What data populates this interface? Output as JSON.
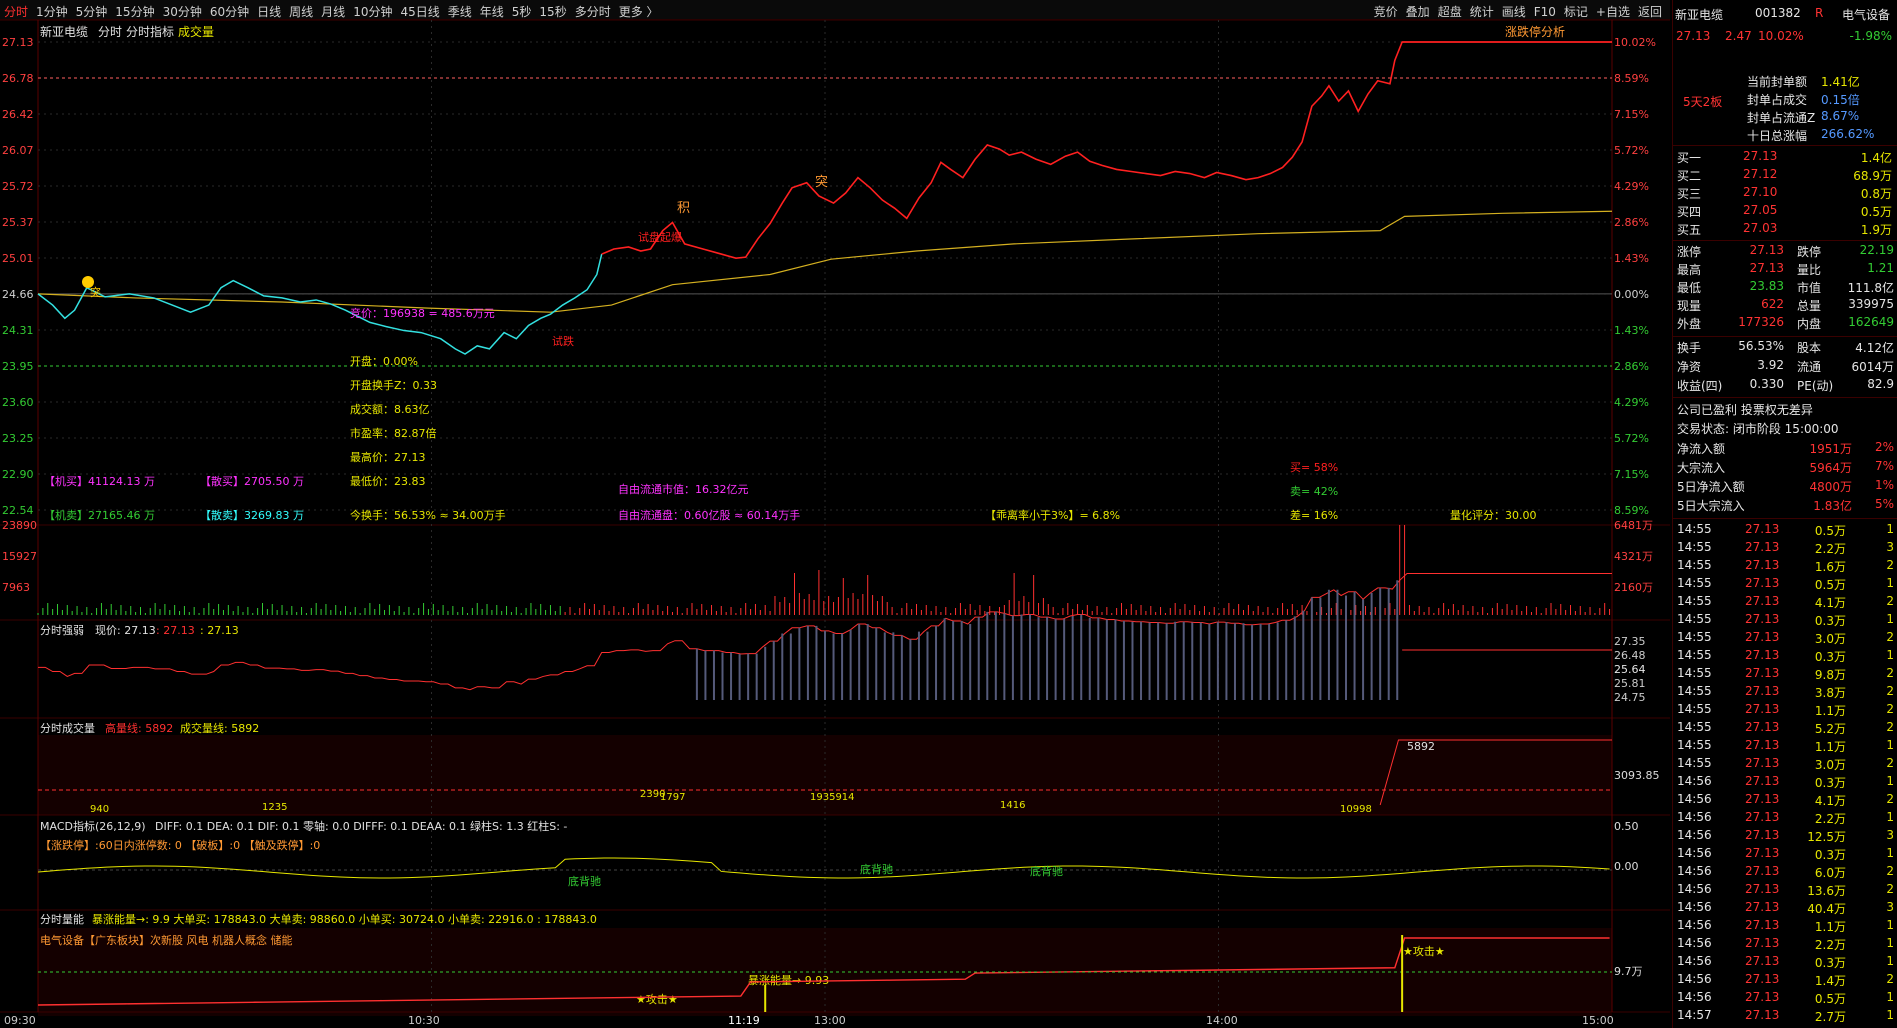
{
  "toolbar": {
    "left": [
      "分时",
      "1分钟",
      "5分钟",
      "15分钟",
      "30分钟",
      "60分钟",
      "日线",
      "周线",
      "月线",
      "10分钟",
      "45日线",
      "季线",
      "年线",
      "5秒",
      "15秒",
      "多分时",
      "更多 〉"
    ],
    "right": [
      "竞价",
      "叠加",
      "超盘",
      "统计",
      "画线",
      "F10",
      "标记",
      "+自选",
      "返回"
    ]
  },
  "header": {
    "stock_name": "新亚电缆",
    "tabs": [
      "分时",
      "分时指标",
      "成交量"
    ],
    "right_link": "涨跌停分析"
  },
  "price_axis": {
    "left": [
      "27.13",
      "26.78",
      "26.42",
      "26.07",
      "25.72",
      "25.37",
      "25.01",
      "24.66",
      "24.31",
      "23.95",
      "23.60",
      "23.25",
      "22.90",
      "22.54"
    ],
    "right": [
      "10.02%",
      "8.59%",
      "7.15%",
      "5.72%",
      "4.29%",
      "2.86%",
      "1.43%",
      "0.00%",
      "1.43%",
      "2.86%",
      "4.29%",
      "5.72%",
      "7.15%",
      "8.59%"
    ]
  },
  "main_annotations": {
    "auction": "竞价：196938 = 485.6万元",
    "stats": [
      "开盘：0.00%",
      "开盘换手Z：0.33",
      "成交额：8.63亿",
      "市盈率：82.87倍",
      "最高价：27.13",
      "最低价：23.83"
    ],
    "markers": [
      "突",
      "积",
      "突",
      "试盘起爆",
      "试跌",
      "买"
    ],
    "jimai": "【机买】41124.13 万",
    "sanmai": "【散买】2705.50 万",
    "jimai2": "【机卖】27165.46 万",
    "sanmai2": "【散卖】3269.83 万",
    "turnover": "今换手：56.53% ≈ 34.00万手",
    "float_value": "自由流通市值：16.32亿元",
    "float_shares": "自由流通盘：0.60亿股 ≈ 60.14万手",
    "deviation": "【乖离率小于3%】= 6.8%",
    "buy_ratio": "买= 58%",
    "sell_ratio": "卖= 42%",
    "diff_ratio": "差= 16%",
    "quant_score": "量化评分：30.00"
  },
  "volume_axis": {
    "left": [
      "23890",
      "15927",
      "7963"
    ],
    "right": [
      "6481万",
      "4321万",
      "2160万"
    ]
  },
  "panel_strength": {
    "title": "分时强弱",
    "now_label": "现价: 27.13",
    "v1": ": 27.13",
    "v2": ": 27.13",
    "axis": [
      "27.35",
      "26.48",
      "25.64",
      "25.81",
      "24.75"
    ]
  },
  "panel_volume": {
    "title": "分时成交量",
    "high_label": "高量线: 5892",
    "line_label": "成交量线: 5892",
    "axis": "3093.85",
    "peak": "5892",
    "labels": [
      "940",
      "1235",
      "1797",
      "2390",
      "1935914",
      "1416",
      "10998"
    ]
  },
  "panel_macd": {
    "title": "MACD指标(26,12,9)",
    "values": "DIFF: 0.1  DEA: 0.1  DIF: 0.1  零轴: 0.0  DIFFF: 0.1  DEAA: 0.1  绿柱S: 1.3  红柱S: -",
    "line2": "【涨跌停】:60日内涨停数: 0  【破板】:0  【触及跌停】:0",
    "axis": [
      "0.50",
      "0.00"
    ],
    "markers": [
      "底背驰",
      "底背驰",
      "底背驰"
    ]
  },
  "panel_energy": {
    "title": "分时量能",
    "values": "暴涨能量→: 9.9  大单买: 178843.0  大单卖: 98860.0  小单买: 30724.0  小单卖: 22916.0 : 178843.0",
    "sector": "电气设备【广东板块】次新股 风电 机器人概念 储能",
    "attack": "★攻击★",
    "energy_label": "暴涨能量→ 9.93",
    "axis": "9.7万"
  },
  "time_axis": [
    "09:30",
    "10:30",
    "11:19",
    "13:00",
    "14:00",
    "15:00"
  ],
  "quote": {
    "name": "新亚电缆",
    "code": "001382",
    "tag": "R",
    "sector": "电气设备",
    "sector_change": "-1.98%",
    "price": "27.13",
    "change": "2.47",
    "pct": "10.02%",
    "board_tag": "5天2板",
    "seal": [
      [
        "当前封单额",
        "1.41亿"
      ],
      [
        "封单占成交",
        "0.15倍"
      ],
      [
        "封单占流通Z",
        "8.67%"
      ],
      [
        "十日总涨幅",
        "266.62%"
      ]
    ],
    "bids": [
      [
        "买一",
        "27.13",
        "1.4亿"
      ],
      [
        "买二",
        "27.12",
        "68.9万"
      ],
      [
        "买三",
        "27.10",
        "0.8万"
      ],
      [
        "买四",
        "27.05",
        "0.5万"
      ],
      [
        "买五",
        "27.03",
        "1.9万"
      ]
    ],
    "stats": [
      [
        "涨停",
        "27.13",
        "跌停",
        "22.19"
      ],
      [
        "最高",
        "27.13",
        "量比",
        "1.21"
      ],
      [
        "最低",
        "23.83",
        "市值",
        "111.8亿"
      ],
      [
        "现量",
        "622",
        "总量",
        "339975"
      ],
      [
        "外盘",
        "177326",
        "内盘",
        "162649"
      ]
    ],
    "stats2": [
      [
        "换手",
        "56.53%",
        "股本",
        "4.12亿"
      ],
      [
        "净资",
        "3.92",
        "流通",
        "6014万"
      ],
      [
        "收益(四)",
        "0.330",
        "PE(动)",
        "82.9"
      ]
    ],
    "notice": "公司已盈利 投票权无差异",
    "status": "交易状态: 闭市阶段 15:00:00",
    "flows": [
      [
        "净流入额",
        "1951万",
        "2%"
      ],
      [
        "大宗流入",
        "5964万",
        "7%"
      ],
      [
        "5日净流入额",
        "4800万",
        "1%"
      ],
      [
        "5日大宗流入",
        "1.83亿",
        "5%"
      ]
    ],
    "ticks": [
      [
        "14:55",
        "27.13",
        "0.5万",
        "1"
      ],
      [
        "14:55",
        "27.13",
        "2.2万",
        "3"
      ],
      [
        "14:55",
        "27.13",
        "1.6万",
        "2"
      ],
      [
        "14:55",
        "27.13",
        "0.5万",
        "1"
      ],
      [
        "14:55",
        "27.13",
        "4.1万",
        "2"
      ],
      [
        "14:55",
        "27.13",
        "0.3万",
        "1"
      ],
      [
        "14:55",
        "27.13",
        "3.0万",
        "2"
      ],
      [
        "14:55",
        "27.13",
        "0.3万",
        "1"
      ],
      [
        "14:55",
        "27.13",
        "9.8万",
        "2"
      ],
      [
        "14:55",
        "27.13",
        "3.8万",
        "2"
      ],
      [
        "14:55",
        "27.13",
        "1.1万",
        "2"
      ],
      [
        "14:55",
        "27.13",
        "5.2万",
        "2"
      ],
      [
        "14:55",
        "27.13",
        "1.1万",
        "1"
      ],
      [
        "14:55",
        "27.13",
        "3.0万",
        "2"
      ],
      [
        "14:56",
        "27.13",
        "0.3万",
        "1"
      ],
      [
        "14:56",
        "27.13",
        "4.1万",
        "2"
      ],
      [
        "14:56",
        "27.13",
        "2.2万",
        "1"
      ],
      [
        "14:56",
        "27.13",
        "12.5万",
        "3"
      ],
      [
        "14:56",
        "27.13",
        "0.3万",
        "1"
      ],
      [
        "14:56",
        "27.13",
        "6.0万",
        "2"
      ],
      [
        "14:56",
        "27.13",
        "13.6万",
        "2"
      ],
      [
        "14:56",
        "27.13",
        "40.4万",
        "3"
      ],
      [
        "14:56",
        "27.13",
        "1.1万",
        "1"
      ],
      [
        "14:56",
        "27.13",
        "2.2万",
        "1"
      ],
      [
        "14:56",
        "27.13",
        "0.3万",
        "1"
      ],
      [
        "14:56",
        "27.13",
        "1.4万",
        "2"
      ],
      [
        "14:56",
        "27.13",
        "0.5万",
        "1"
      ],
      [
        "14:57",
        "27.13",
        "2.7万",
        "1"
      ]
    ]
  },
  "chart_data": {
    "type": "line",
    "title": "新亚电缆 分时",
    "prev_close": 24.66,
    "ylim": [
      22.54,
      27.13
    ],
    "price_series": [
      [
        0,
        24.66
      ],
      [
        12,
        24.55
      ],
      [
        22,
        24.42
      ],
      [
        30,
        24.5
      ],
      [
        40,
        24.72
      ],
      [
        55,
        24.63
      ],
      [
        75,
        24.66
      ],
      [
        95,
        24.62
      ],
      [
        110,
        24.55
      ],
      [
        125,
        24.48
      ],
      [
        140,
        24.55
      ],
      [
        150,
        24.72
      ],
      [
        160,
        24.79
      ],
      [
        172,
        24.72
      ],
      [
        185,
        24.64
      ],
      [
        200,
        24.62
      ],
      [
        215,
        24.58
      ],
      [
        228,
        24.6
      ],
      [
        240,
        24.56
      ],
      [
        252,
        24.5
      ],
      [
        262,
        24.44
      ],
      [
        272,
        24.38
      ],
      [
        285,
        24.34
      ],
      [
        300,
        24.3
      ],
      [
        314,
        24.28
      ],
      [
        330,
        24.22
      ],
      [
        342,
        24.12
      ],
      [
        350,
        24.07
      ],
      [
        360,
        24.15
      ],
      [
        370,
        24.12
      ],
      [
        382,
        24.28
      ],
      [
        392,
        24.22
      ],
      [
        402,
        24.35
      ],
      [
        412,
        24.42
      ],
      [
        420,
        24.46
      ],
      [
        430,
        24.55
      ],
      [
        440,
        24.62
      ],
      [
        450,
        24.7
      ],
      [
        458,
        24.85
      ],
      [
        462,
        25.05
      ],
      [
        472,
        25.1
      ],
      [
        484,
        25.12
      ],
      [
        494,
        25.08
      ],
      [
        502,
        25.1
      ],
      [
        512,
        25.28
      ],
      [
        520,
        25.36
      ],
      [
        530,
        25.15
      ],
      [
        545,
        25.1
      ],
      [
        560,
        25.05
      ],
      [
        572,
        25.01
      ],
      [
        580,
        25.02
      ],
      [
        590,
        25.2
      ],
      [
        600,
        25.35
      ],
      [
        610,
        25.55
      ],
      [
        618,
        25.7
      ],
      [
        630,
        25.75
      ],
      [
        640,
        25.62
      ],
      [
        652,
        25.55
      ],
      [
        662,
        25.65
      ],
      [
        672,
        25.8
      ],
      [
        682,
        25.7
      ],
      [
        692,
        25.58
      ],
      [
        702,
        25.5
      ],
      [
        712,
        25.4
      ],
      [
        722,
        25.6
      ],
      [
        732,
        25.75
      ],
      [
        740,
        25.95
      ],
      [
        748,
        25.88
      ],
      [
        758,
        25.8
      ],
      [
        768,
        25.98
      ],
      [
        778,
        26.12
      ],
      [
        788,
        26.08
      ],
      [
        796,
        26.02
      ],
      [
        806,
        26.05
      ],
      [
        818,
        25.98
      ],
      [
        830,
        25.93
      ],
      [
        842,
        26.01
      ],
      [
        852,
        26.05
      ],
      [
        862,
        25.96
      ],
      [
        872,
        25.92
      ],
      [
        884,
        25.88
      ],
      [
        896,
        25.86
      ],
      [
        908,
        25.84
      ],
      [
        920,
        25.82
      ],
      [
        932,
        25.86
      ],
      [
        944,
        25.84
      ],
      [
        956,
        25.8
      ],
      [
        966,
        25.85
      ],
      [
        978,
        25.82
      ],
      [
        990,
        25.78
      ],
      [
        1000,
        25.8
      ],
      [
        1010,
        25.84
      ],
      [
        1020,
        25.9
      ],
      [
        1028,
        26.0
      ],
      [
        1036,
        26.15
      ],
      [
        1044,
        26.5
      ],
      [
        1052,
        26.6
      ],
      [
        1058,
        26.7
      ],
      [
        1066,
        26.55
      ],
      [
        1074,
        26.65
      ],
      [
        1082,
        26.45
      ],
      [
        1090,
        26.62
      ],
      [
        1098,
        26.75
      ],
      [
        1108,
        26.72
      ],
      [
        1112,
        26.95
      ],
      [
        1118,
        27.13
      ],
      [
        1290,
        27.13
      ]
    ],
    "avg_series": [
      [
        0,
        24.66
      ],
      [
        80,
        24.62
      ],
      [
        200,
        24.58
      ],
      [
        320,
        24.52
      ],
      [
        420,
        24.48
      ],
      [
        470,
        24.55
      ],
      [
        520,
        24.75
      ],
      [
        600,
        24.85
      ],
      [
        650,
        25.0
      ],
      [
        720,
        25.08
      ],
      [
        800,
        25.15
      ],
      [
        900,
        25.2
      ],
      [
        1000,
        25.25
      ],
      [
        1100,
        25.28
      ],
      [
        1120,
        25.42
      ],
      [
        1200,
        25.45
      ],
      [
        1290,
        25.47
      ]
    ]
  }
}
